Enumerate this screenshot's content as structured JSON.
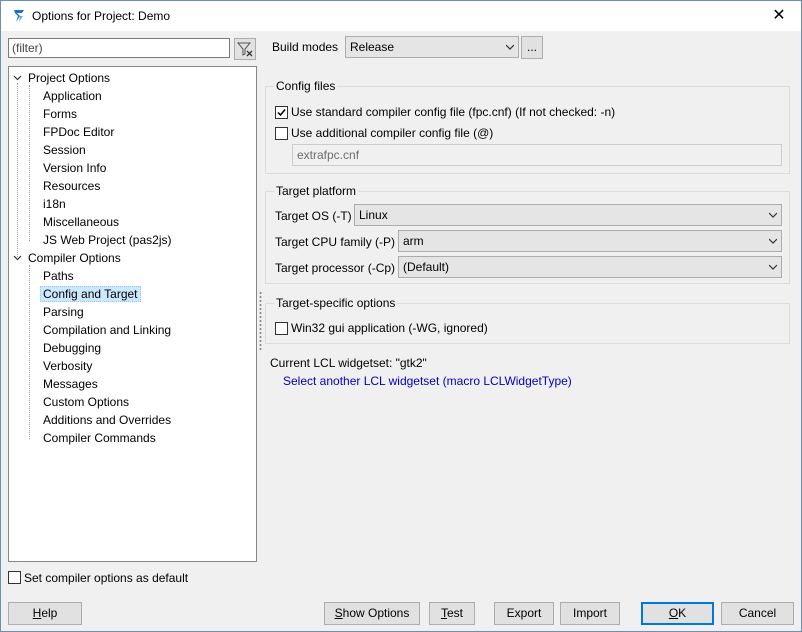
{
  "window": {
    "title": "Options for Project: Demo",
    "close_glyph": "✕"
  },
  "filter": {
    "placeholder": "(filter)"
  },
  "tree": {
    "project_options": "Project Options",
    "project_children": [
      "Application",
      "Forms",
      "FPDoc Editor",
      "Session",
      "Version Info",
      "Resources",
      "i18n",
      "Miscellaneous",
      "JS Web Project (pas2js)"
    ],
    "compiler_options": "Compiler Options",
    "compiler_children": [
      "Paths",
      "Config and Target",
      "Parsing",
      "Compilation and Linking",
      "Debugging",
      "Verbosity",
      "Messages",
      "Custom Options",
      "Additions and Overrides",
      "Compiler Commands"
    ],
    "selected": "Config and Target"
  },
  "build_modes": {
    "label": "Build modes",
    "value": "Release",
    "button": "..."
  },
  "config_files": {
    "title": "Config files",
    "use_standard": {
      "label": "Use standard compiler config file (fpc.cnf) (If not checked: -n)",
      "checked": true
    },
    "use_additional": {
      "label": "Use additional compiler config file (@)",
      "checked": false
    },
    "additional_file": "extrafpc.cnf"
  },
  "target_platform": {
    "title": "Target platform",
    "os_label": "Target OS (-T)",
    "os_value": "Linux",
    "cpu_label": "Target CPU family (-P)",
    "cpu_value": "arm",
    "processor_label": "Target processor (-Cp)",
    "processor_value": "(Default)"
  },
  "target_specific": {
    "title": "Target-specific options",
    "win32_gui": {
      "label": "Win32 gui application (-WG, ignored)",
      "checked": false
    }
  },
  "lcl": {
    "current": "Current LCL widgetset: \"gtk2\"",
    "select_link": "Select another LCL widgetset (macro LCLWidgetType)"
  },
  "default_checkbox": {
    "label": "Set compiler options as default",
    "checked": false
  },
  "buttons": {
    "help_first": "H",
    "help_rest": "elp",
    "show_first": "S",
    "show_rest": "how Options",
    "test_first": "T",
    "test_rest": "est",
    "export": "Export",
    "import": "Import",
    "ok_first": "O",
    "ok_rest": "K",
    "cancel": "Cancel"
  },
  "colors": {
    "link": "#0000c0",
    "selection": "#cce8ff",
    "default_button_border": "#0078d7"
  }
}
